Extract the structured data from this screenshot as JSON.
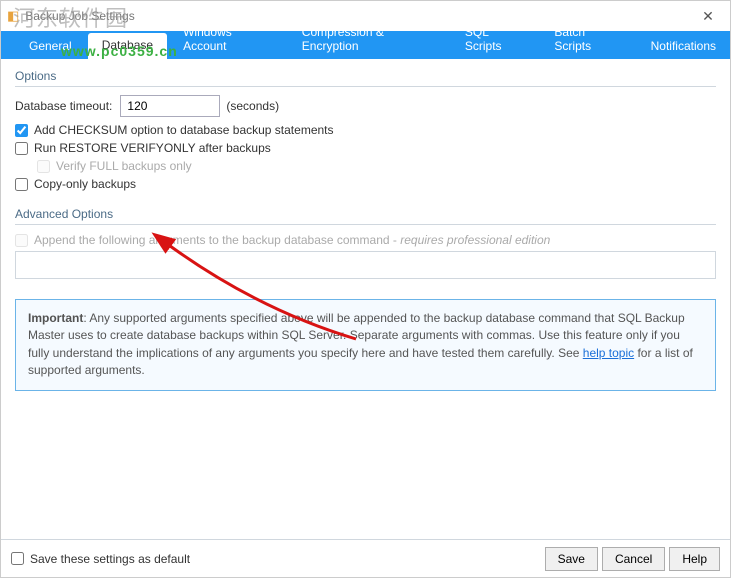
{
  "window": {
    "title": "Backup Job Settings"
  },
  "watermark": {
    "text1": "河东软件园",
    "text2": "www.pc0359.cn"
  },
  "tabs": {
    "general": "General",
    "database": "Database",
    "windows_account": "Windows Account",
    "compression": "Compression & Encryption",
    "sql_scripts": "SQL Scripts",
    "batch_scripts": "Batch Scripts",
    "notifications": "Notifications"
  },
  "options": {
    "group_label": "Options",
    "timeout_label": "Database timeout:",
    "timeout_value": "120",
    "timeout_suffix": "(seconds)",
    "checksum_label": "Add CHECKSUM option to database backup statements",
    "restore_verify_label": "Run RESTORE VERIFYONLY after backups",
    "verify_full_label": "Verify FULL backups only",
    "copy_only_label": "Copy-only backups"
  },
  "advanced": {
    "group_label": "Advanced Options",
    "append_label": "Append the following arguments to the backup database command - ",
    "append_note": "requires professional edition"
  },
  "important": {
    "bold": "Important",
    "text1": ": Any supported arguments specified above will be appended to the backup database command that SQL Backup Master uses to create database backups within SQL Server. Separate arguments with commas. Use this feature only if you fully understand the implications of any arguments you specify here and have tested them carefully. See ",
    "link": "help topic",
    "text2": " for a list of supported arguments."
  },
  "footer": {
    "save_default": "Save these settings as default",
    "save": "Save",
    "cancel": "Cancel",
    "help": "Help"
  }
}
